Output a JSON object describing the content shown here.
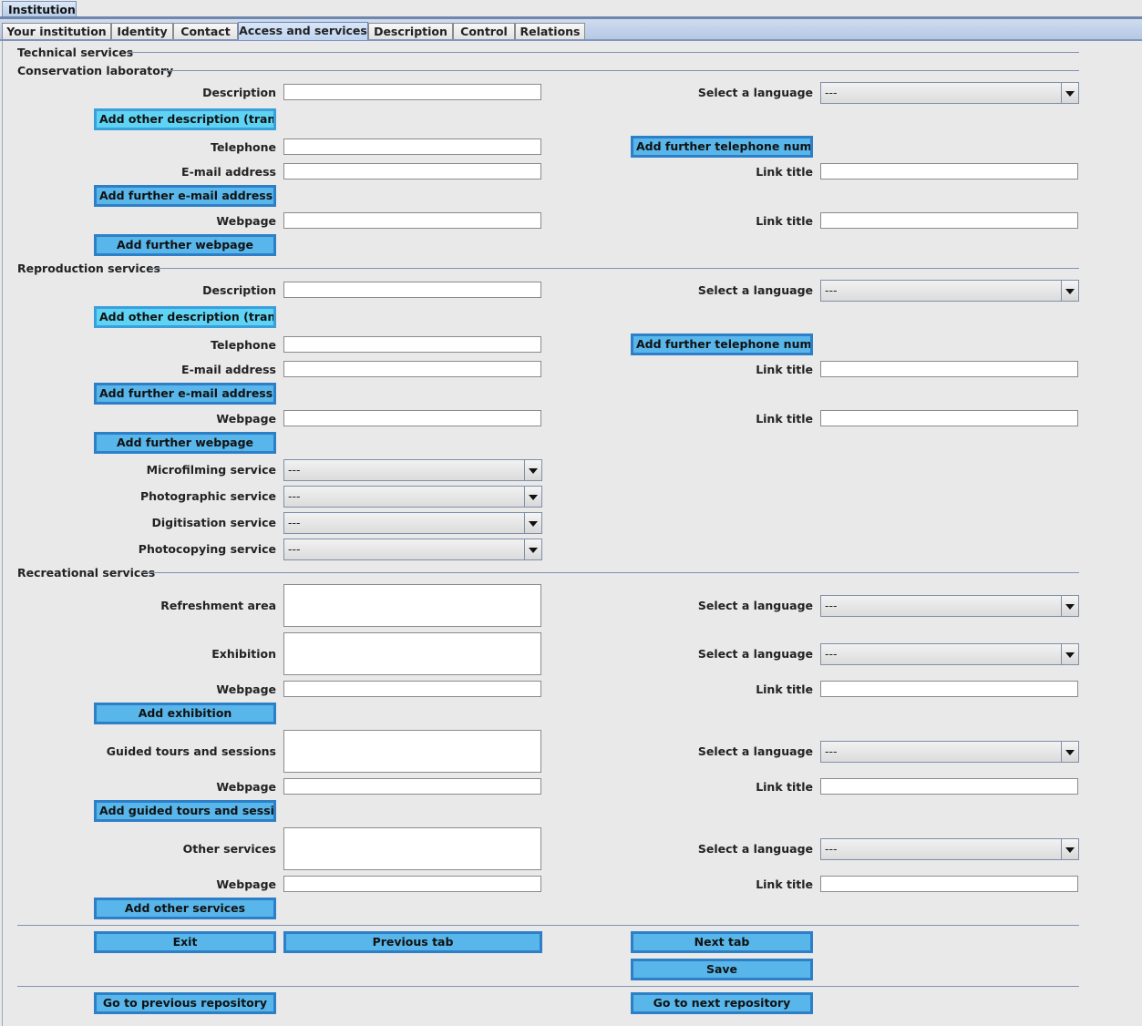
{
  "window": {
    "outer_tab": "Institution"
  },
  "tabs": [
    "Your institution",
    "Identity",
    "Contact",
    "Access and services",
    "Description",
    "Control",
    "Relations"
  ],
  "sections": {
    "technical": "Technical services",
    "conservation": "Conservation laboratory",
    "reproduction": "Reproduction services",
    "recreational": "Recreational services"
  },
  "labels": {
    "description": "Description",
    "select_language": "Select a language",
    "telephone": "Telephone",
    "email": "E-mail address",
    "link_title": "Link title",
    "webpage": "Webpage",
    "microfilming": "Microfilming service",
    "photographic": "Photographic service",
    "digitisation": "Digitisation service",
    "photocopying": "Photocopying service",
    "refreshment": "Refreshment area",
    "exhibition": "Exhibition",
    "guided_tours": "Guided tours and sessions",
    "other_services": "Other services"
  },
  "buttons": {
    "add_other_description": "Add other description (transl...",
    "add_telephone": "Add further telephone number",
    "add_email": "Add further e-mail address",
    "add_webpage": "Add further webpage",
    "add_exhibition": "Add exhibition",
    "add_guided_tours": "Add guided tours and sessio...",
    "add_other_services": "Add other services",
    "exit": "Exit",
    "previous_tab": "Previous tab",
    "next_tab": "Next tab",
    "save": "Save",
    "prev_repository": "Go to previous repository",
    "next_repository": "Go to next repository"
  },
  "combo_default": "---",
  "colors": {
    "button_fill": "#58b6ea",
    "button_border": "#2d80c7",
    "tab_active": "#bfd3ef"
  }
}
